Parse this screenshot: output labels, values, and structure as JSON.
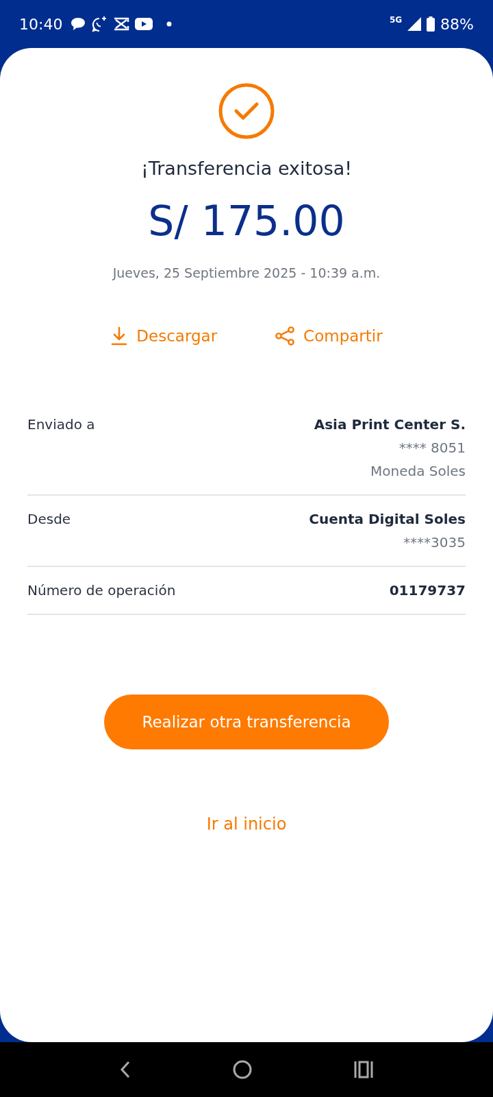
{
  "status_bar": {
    "time": "10:40",
    "network": "5G",
    "battery": "88%"
  },
  "title": "¡Transferencia exitosa!",
  "amount": "S/ 175.00",
  "date": "Jueves, 25 Septiembre 2025 - 10:39 a.m.",
  "actions": [
    {
      "kind": "download",
      "label": "Descargar"
    },
    {
      "kind": "share",
      "label": "Compartir"
    }
  ],
  "details": [
    {
      "label": "Enviado a",
      "values": [
        "Asia Print Center S.",
        "**** 8051",
        "Moneda Soles"
      ]
    },
    {
      "label": "Desde",
      "values": [
        "Cuenta Digital Soles",
        "****3035"
      ]
    },
    {
      "label": "Número de operación",
      "values": [
        "01179737"
      ]
    }
  ],
  "primary_button": "Realizar otra transferencia",
  "link": "Ir al inicio"
}
